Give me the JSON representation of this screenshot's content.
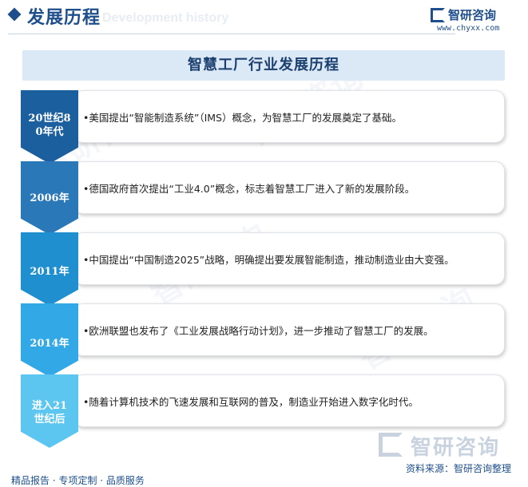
{
  "header": {
    "title": "发展历程",
    "subtitle_en": "Development history"
  },
  "brand": {
    "name": "智研咨询",
    "url": "www.chyxx.com",
    "color": "#1e4f8c"
  },
  "banner": {
    "title": "智慧工厂行业发展历程"
  },
  "timeline": [
    {
      "period": "20世纪80年代",
      "text": "•美国提出“智能制造系统”（IMS）概念，为智慧工厂的发展奠定了基础。",
      "color": "#1c5f9e"
    },
    {
      "period": "2006年",
      "text": "•德国政府首次提出“工业4.0”概念，标志着智慧工厂进入了新的发展阶段。",
      "color": "#2a78b8"
    },
    {
      "period": "2011年",
      "text": "•中国提出“中国制造2025”战略，明确提出要发展智能制造，推动制造业由大变强。",
      "color": "#1f8fd0"
    },
    {
      "period": "2014年",
      "text": "•欧洲联盟也发布了《工业发展战略行动计划》，进一步推动了智慧工厂的发展。",
      "color": "#32a8e6"
    },
    {
      "period": "进入21世纪后",
      "text": "•随着计算机技术的飞速发展和互联网的普及，制造业开始进入数字化时代。",
      "color": "#5cc6f0"
    }
  ],
  "footer": {
    "tagline": "精品报告 · 专项定制 · 品质服务",
    "source": "资料来源：智研咨询整理",
    "logo_text": "智研咨询"
  }
}
